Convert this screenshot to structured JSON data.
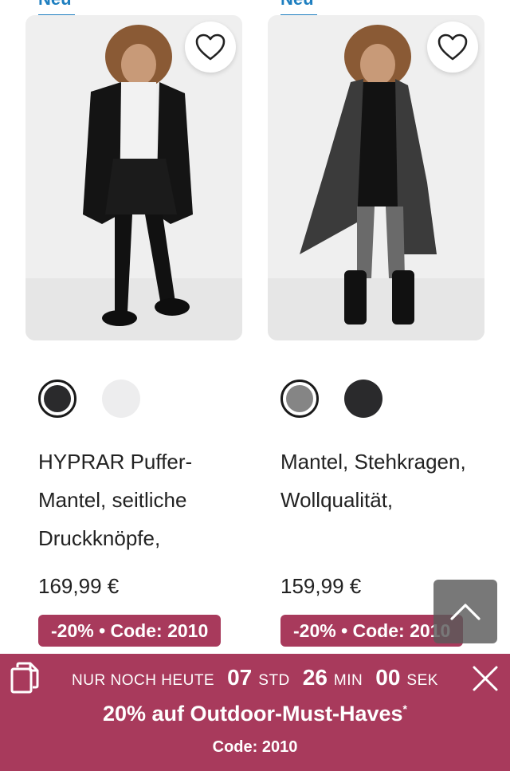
{
  "products": [
    {
      "badge": "Neu",
      "image_alt": "Frau in schwarzem Puffer-Mantel",
      "swatch_colors": [
        "#2a2a2c",
        "#ededee"
      ],
      "selected_swatch": 0,
      "title": "HYPRAR Puffer-Mantel, seitliche Druckknöpfe,",
      "price": "169,99 €",
      "promo": "-20% • Code: 2010"
    },
    {
      "badge": "Neu",
      "image_alt": "Frau in grauem Wollmantel mit Stehkragen",
      "swatch_colors": [
        "#858585",
        "#2a2a2c"
      ],
      "selected_swatch": 0,
      "title": "Mantel, Stehkragen, Wollqualität,",
      "price": "159,99 €",
      "promo": "-20% • Code: 2010"
    }
  ],
  "banner": {
    "countdown_label": "NUR NOCH HEUTE",
    "hours": "07",
    "hours_unit": "STD",
    "minutes": "26",
    "minutes_unit": "MIN",
    "seconds": "00",
    "seconds_unit": "SEK",
    "headline": "20% auf Outdoor-Must-Haves",
    "headline_mark": "*",
    "code": "Code: 2010"
  },
  "colors": {
    "accent": "#a83a5c",
    "badge_blue": "#1e7fc0"
  },
  "icons": {
    "favorite": "heart-outline-icon",
    "scroll_top": "chevron-up-icon",
    "copy": "copy-icon",
    "close": "close-icon"
  }
}
